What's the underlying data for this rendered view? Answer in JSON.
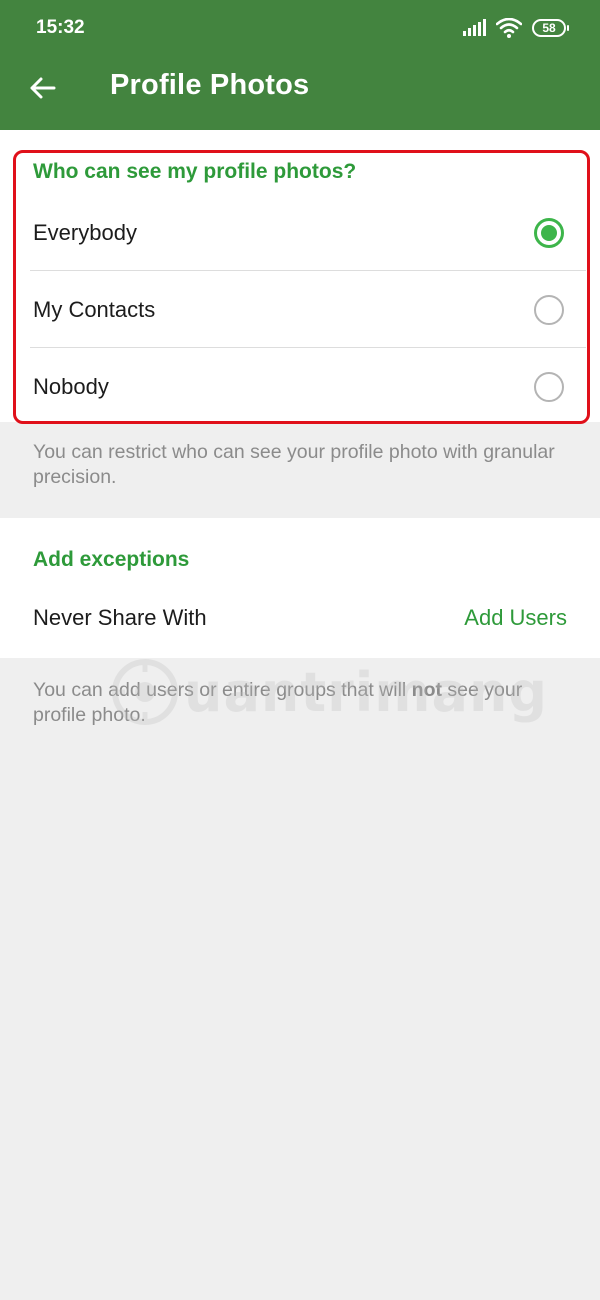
{
  "status_bar": {
    "time": "15:32",
    "battery": "58"
  },
  "app_bar": {
    "title": "Profile Photos"
  },
  "visibility": {
    "heading": "Who can see my profile photos?",
    "options": [
      {
        "label": "Everybody",
        "selected": true
      },
      {
        "label": "My Contacts",
        "selected": false
      },
      {
        "label": "Nobody",
        "selected": false
      }
    ],
    "helper": "You can restrict who can see your profile photo with granular precision."
  },
  "exceptions": {
    "heading": "Add exceptions",
    "never_share_label": "Never Share With",
    "add_users_label": "Add Users",
    "helper_before": "You can add users or entire groups that will ",
    "helper_emphasis": "not",
    "helper_after": " see your profile photo."
  },
  "watermark": {
    "text": "uantrimang"
  },
  "colors": {
    "header": "#43843f",
    "accent": "#2e9a3a",
    "radio_selected": "#3db54a",
    "highlight": "#e0101a"
  }
}
